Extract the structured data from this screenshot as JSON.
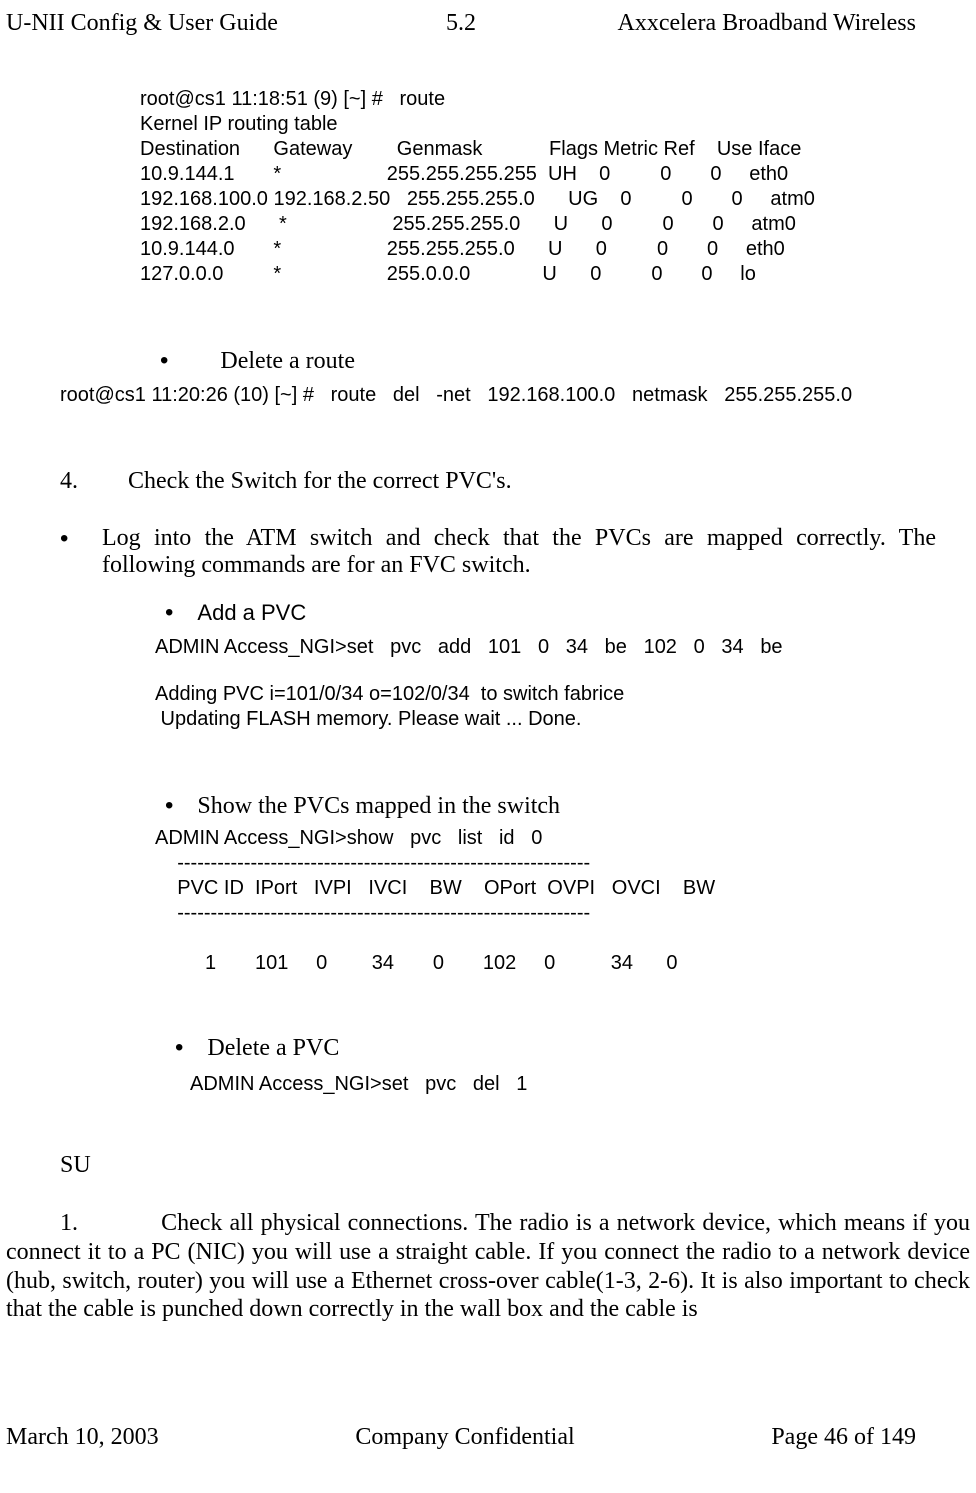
{
  "header": {
    "left": "U-NII Config & User Guide",
    "version": "5.2",
    "right": "Axxcelera Broadband Wireless"
  },
  "route_block": "root@cs1 11:18:51 (9) [~] #   route\nKernel IP routing table\nDestination      Gateway        Genmask            Flags Metric Ref    Use Iface\n10.9.144.1       *                   255.255.255.255  UH    0         0       0     eth0\n192.168.100.0 192.168.2.50   255.255.255.0      UG    0         0       0     atm0\n192.168.2.0      *                   255.255.255.0      U      0         0       0     atm0\n10.9.144.0       *                   255.255.255.0      U      0         0       0     eth0\n127.0.0.0         *                   255.0.0.0             U      0         0       0     lo",
  "del_route_heading": "Delete a route",
  "del_route_cmd": "root@cs1 11:20:26 (10) [~] #   route   del   -net   192.168.100.0   netmask   255.255.255.0",
  "step4_label": "4.",
  "step4_text": "Check the Switch for the correct PVC's.",
  "log_bullet_text": "Log into the ATM switch and check that the PVCs are mapped correctly. The following commands are for an FVC switch.",
  "add_pvc_heading": "Add a PVC",
  "add_pvc_cmd": "ADMIN Access_NGI>set   pvc   add   101   0   34   be   102   0   34   be",
  "add_pvc_out": "Adding PVC i=101/0/34 o=102/0/34  to switch fabrice\n Updating FLASH memory. Please wait ... Done.",
  "show_pvc_heading": "Show the PVCs mapped in the switch",
  "show_pvc_block": "ADMIN Access_NGI>show   pvc   list   id   0\n    --------------------------------------------------------------\n    PVC ID  IPort   IVPI   IVCI    BW    OPort  OVPI   OVCI    BW\n    --------------------------------------------------------------\n\n         1       101     0        34       0       102     0          34      0",
  "del_pvc_heading": "Delete a PVC",
  "del_pvc_cmd": "ADMIN Access_NGI>set   pvc   del   1",
  "su_label": "SU",
  "su_step_num": "1.",
  "su_step_text": "Check all physical connections. The radio is a network device, which means if you connect it to a PC (NIC) you will use a straight cable. If you  connect the radio to a network device (hub, switch, router) you will use a Ethernet cross-over cable(1-3, 2-6). It is also important to check that the cable is punched down correctly in the wall box and the cable is",
  "footer": {
    "date": "March 10, 2003",
    "center": "Company Confidential",
    "page": "Page 46 of 149"
  }
}
